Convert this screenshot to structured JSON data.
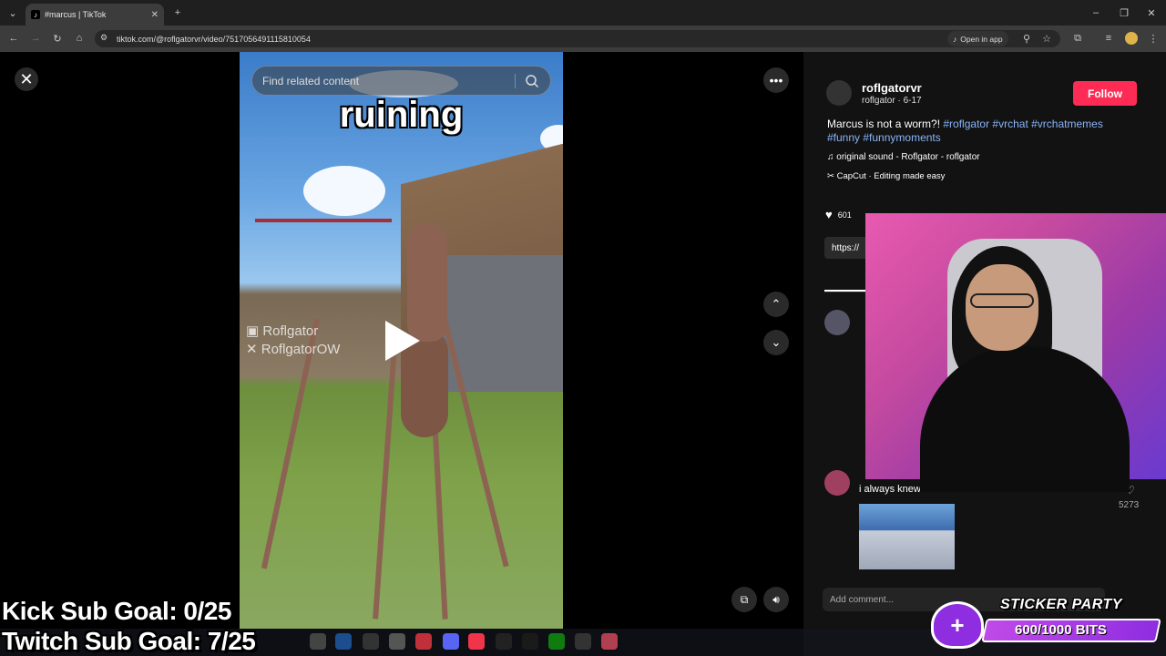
{
  "browser": {
    "tab_title": "#marcus | TikTok",
    "url": "tiktok.com/@roflgatorvr/video/7517056491115810054",
    "open_in_app": "Open in app"
  },
  "video": {
    "search_placeholder": "Find related content",
    "caption": "ruining",
    "watermark_line1": "Roflgator",
    "watermark_line2": "RoflgatorOW"
  },
  "post": {
    "username": "roflgatorvr",
    "subline": "roflgator · 6-17",
    "follow_label": "Follow",
    "description": "Marcus is not a worm?! ",
    "hashtags": [
      "#roflgator",
      "#vrchat",
      "#vrchatmemes",
      "#funny",
      "#funnymoments"
    ],
    "sound": "original sound - Roflgator - roflgator",
    "capcut": "CapCut · Editing made easy",
    "likes": "601",
    "link": "https://"
  },
  "comments": [
    {
      "text": "i always knew he was a sardine",
      "likes": "5273"
    }
  ],
  "add_comment_placeholder": "Add comment...",
  "overlay": {
    "kick_goal": "Kick Sub Goal: 0/25",
    "twitch_goal": "Twitch Sub Goal: 7/25",
    "sticker_party": "STICKER PARTY",
    "bits": "600/1000 BITS"
  },
  "colors": {
    "follow": "#fe2c55",
    "hashtag": "#8ab4f8",
    "bits": "#8f2de0"
  }
}
